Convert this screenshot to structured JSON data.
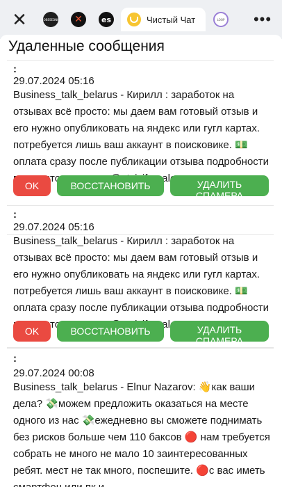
{
  "toolbar": {
    "close_glyph": "✕",
    "more_glyph": "•••",
    "tabs": [
      {
        "icon": "channel-icon-1",
        "glyph": "SOBESEDNIK"
      },
      {
        "icon": "channel-icon-x",
        "glyph": "✕"
      },
      {
        "icon": "channel-icon-es",
        "glyph": "es"
      },
      {
        "icon": "smiley-icon",
        "label": "Чистый Чат",
        "active": true
      },
      {
        "icon": "channel-icon-loop",
        "glyph": "LOOP"
      }
    ]
  },
  "page": {
    "title": "Удаленные сообщения"
  },
  "messages": [
    {
      "prefix": ":",
      "date": "29.07.2024 05:16",
      "text": "Business_talk_belarus - Кирилл : заработок на отзывах всё просто: мы даем вам готовый отзыв и его нужно опубликовать на яндекс или гугл картах. потребуется лишь ваш аккаунт в поисковике. 💵 оплата сразу после публикации отзыва подробности в закрытом канале: @otziviforsale",
      "ok_label": "OK",
      "restore_label": "ВОССТАНОВИТЬ",
      "delete_label": "УДАЛИТЬ СПАМЕРА"
    },
    {
      "prefix": ":",
      "date": "29.07.2024 05:16",
      "text": "Business_talk_belarus - Кирилл : заработок на отзывах всё просто: мы даем вам готовый отзыв и его нужно опубликовать на яндекс или гугл картах. потребуется лишь ваш аккаунт в поисковике. 💵 оплата сразу после публикации отзыва подробности в закрытом канале: @otziviforsale",
      "ok_label": "OK",
      "restore_label": "ВОССТАНОВИТЬ",
      "delete_label": "УДАЛИТЬ СПАМЕРА"
    },
    {
      "prefix": ":",
      "date": "29.07.2024 00:08",
      "text": "Business_talk_belarus - Elnur Nazarov: 👋как ваши дела? 💸можем предложить оказаться на месте одного из нас 💸ежедневно вы сможете поднимать без рисков больше чем 110 баксов 🔴 нам требуется собрать не много не мало 10 заинтересованных ребят. мест не так много, поспешите. 🔴с вас иметь смартфон или пк и"
    }
  ],
  "colors": {
    "ok": "#ea4a41",
    "accent": "#4caf50",
    "toolbar_bg": "#eef0f3"
  }
}
